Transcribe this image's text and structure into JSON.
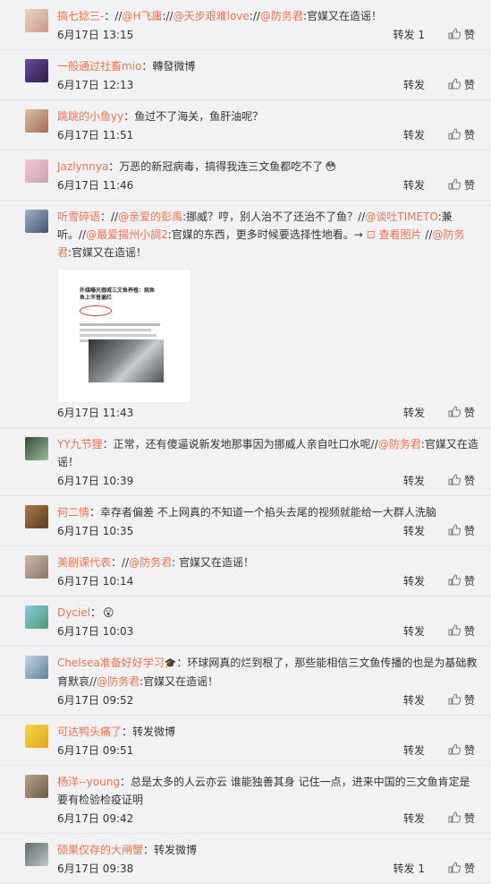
{
  "comments": [
    {
      "user": "搞七捻三-",
      "parts": [
        {
          "t": "：//"
        },
        {
          "m": "@H飞庸"
        },
        {
          "t": "://"
        },
        {
          "m": "@天步艰难love"
        },
        {
          "t": "://"
        },
        {
          "m": "@防务君"
        },
        {
          "t": ":官媒又在造谣！"
        }
      ],
      "time": "6月17日 13:15",
      "forward": "转发 1",
      "like": "赞"
    },
    {
      "user": "一般通过社畜mio",
      "parts": [
        {
          "t": "：轉發微博"
        }
      ],
      "time": "6月17日 12:13",
      "forward": "转发",
      "like": "赞"
    },
    {
      "user": "跳跳的小鱼yy",
      "parts": [
        {
          "t": "：鱼过不了海关，鱼肝油呢？"
        }
      ],
      "time": "6月17日 11:51",
      "forward": "转发",
      "like": "赞"
    },
    {
      "user": "Jazlynnya",
      "parts": [
        {
          "t": "：万恶的新冠病毒，搞得我连三文鱼都吃不了"
        }
      ],
      "emoji": "😳",
      "time": "6月17日 11:46",
      "forward": "转发",
      "like": "赞"
    },
    {
      "user": "听雪碎语",
      "parts": [
        {
          "t": "：//"
        },
        {
          "m": "@亲爱的彭禹"
        },
        {
          "t": ":挪威？哼，别人治不了还治不了鱼？//"
        },
        {
          "m": "@谈吐TIMETO"
        },
        {
          "t": ":兼听。//"
        },
        {
          "m": "@最爱揚州小調2"
        },
        {
          "t": ":官媒的东西，更多时候要选择性地看。→ "
        },
        {
          "p": "查看图片"
        },
        {
          "t": " //"
        },
        {
          "m": "@防务君"
        },
        {
          "t": ":官媒又在造谣！"
        }
      ],
      "time": "6月17日 11:43",
      "forward": "转发",
      "like": "赞",
      "image_text": [
        "外媒曝光挪威三文鱼养殖：病鱼",
        "鱼上市普遍烂"
      ]
    },
    {
      "user": "YY九节狸",
      "parts": [
        {
          "t": "：正常，还有傻逼说新发地那事因为挪威人亲自吐口水呢//"
        },
        {
          "m": "@防务君"
        },
        {
          "t": ":官媒又在造谣！"
        }
      ],
      "time": "6月17日 10:39",
      "forward": "转发",
      "like": "赞"
    },
    {
      "user": "何二情",
      "parts": [
        {
          "t": "：幸存者偏差 不上网真的不知道一个掐头去尾的视频就能给一大群人洗脑"
        }
      ],
      "time": "6月17日 10:35",
      "forward": "转发",
      "like": "赞"
    },
    {
      "user": "美剧课代表",
      "parts": [
        {
          "t": "：//"
        },
        {
          "m": "@防务君"
        },
        {
          "t": ": 官媒又在造谣！"
        }
      ],
      "time": "6月17日 10:14",
      "forward": "转发",
      "like": "赞"
    },
    {
      "user": "Dyciel",
      "parts": [
        {
          "t": "："
        }
      ],
      "emoji": "😮",
      "time": "6月17日 10:03",
      "forward": "转发",
      "like": "赞"
    },
    {
      "user": "Chelsea准备好好学习",
      "badge": "🎓",
      "parts": [
        {
          "t": "：环球网真的烂到根了，那些能相信三文鱼传播的也是为基础教育默哀//"
        },
        {
          "m": "@防务君"
        },
        {
          "t": ":官媒又在造谣！"
        }
      ],
      "time": "6月17日 09:52",
      "forward": "转发",
      "like": "赞"
    },
    {
      "user": "可达鸭头痛了",
      "parts": [
        {
          "t": "：转发微博"
        }
      ],
      "time": "6月17日 09:51",
      "forward": "转发",
      "like": "赞"
    },
    {
      "user": "杨洋--young",
      "parts": [
        {
          "t": "：总是太多的人云亦云 谁能独善其身 记住一点，进来中国的三文鱼肯定是要有检验检疫证明"
        }
      ],
      "time": "6月17日 09:42",
      "forward": "转发",
      "like": "赞"
    },
    {
      "user": "硕果仅存的大闸蟹",
      "parts": [
        {
          "t": "：转发微博"
        }
      ],
      "time": "6月17日 09:38",
      "forward": "转发 1",
      "like": "赞"
    }
  ],
  "colors": {
    "accent": "#eb7350",
    "background": "#f2f2f5"
  }
}
